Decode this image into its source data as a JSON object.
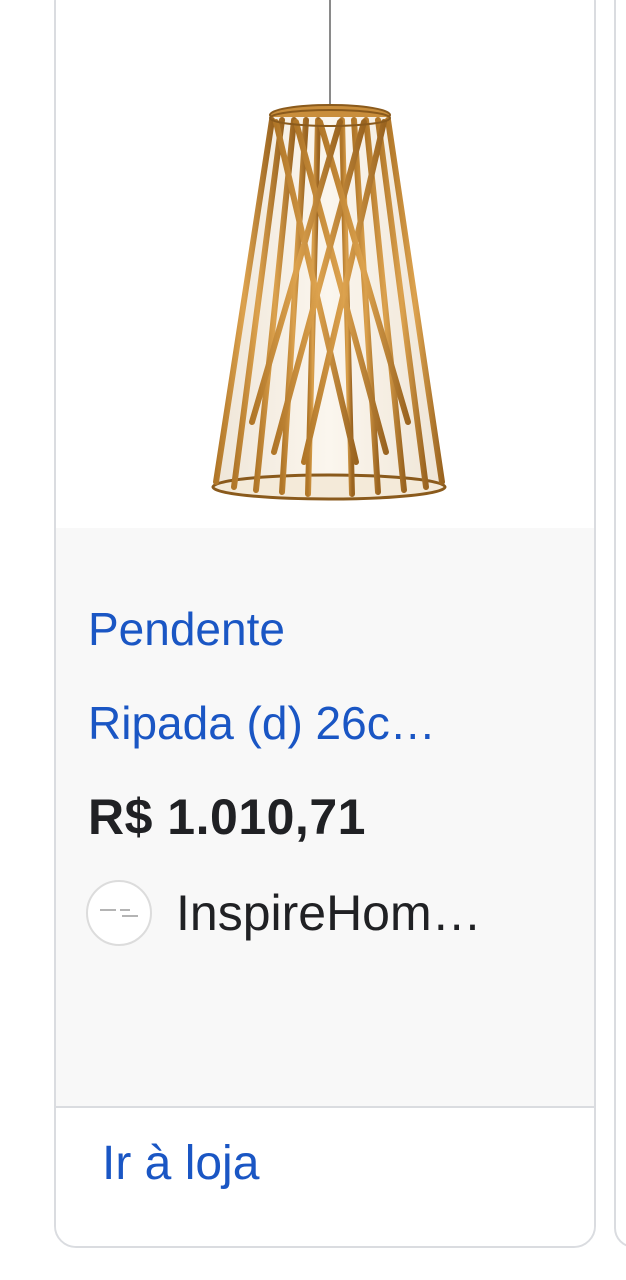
{
  "product": {
    "image_icon": "pendant-lamp-image",
    "title_line1": "Pendente",
    "title_line2": "Ripada (d) 26c…",
    "price": "R$ 1.010,71",
    "merchant": {
      "logo_icon": "inspire-home-logo-icon",
      "name": "InspireHom…"
    },
    "action_label": "Ir à loja"
  },
  "colors": {
    "link": "#1a56c4",
    "text": "#202124",
    "info_background": "#f8f8f8",
    "border": "#dadce0"
  }
}
